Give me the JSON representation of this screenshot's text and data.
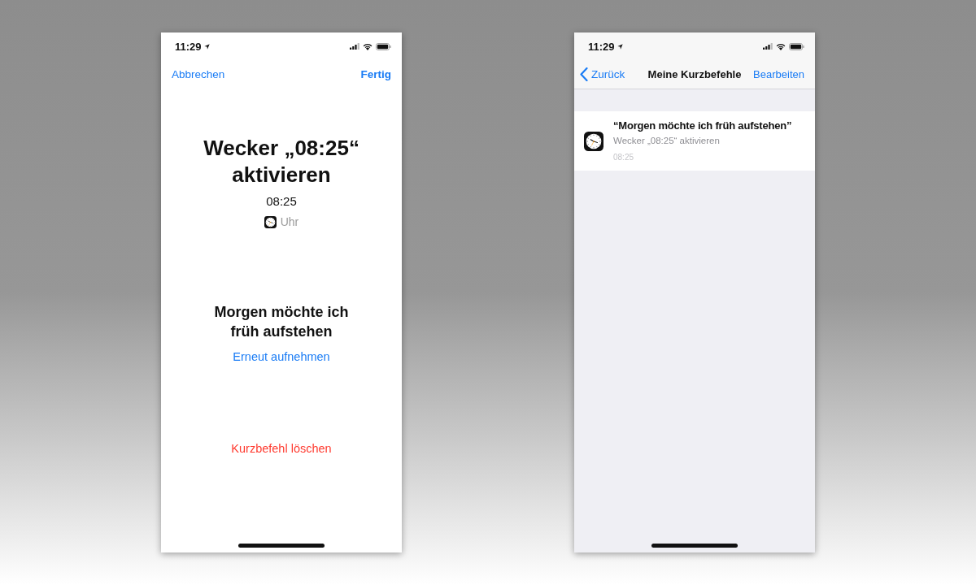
{
  "edit_screen": {
    "status_bar": {
      "time": "11:29"
    },
    "nav_bar": {
      "cancel": "Abbrechen",
      "done": "Fertig"
    },
    "action": {
      "title": "Wecker „08:25“ aktivieren",
      "time": "08:25",
      "app": "Uhr"
    },
    "phrase": {
      "text": "Morgen möchte ich früh aufstehen",
      "rerecord": "Erneut aufnehmen"
    },
    "delete": "Kurzbefehl löschen"
  },
  "list_screen": {
    "status_bar": {
      "time": "11:29"
    },
    "nav_bar": {
      "back": "Zurück",
      "title": "Meine Kurzbefehle",
      "edit": "Bearbeiten"
    },
    "shortcuts": [
      {
        "phrase": "“Morgen möchte ich früh aufstehen”",
        "action": "Wecker „08:25“ aktivieren",
        "time": "08:25"
      }
    ]
  }
}
